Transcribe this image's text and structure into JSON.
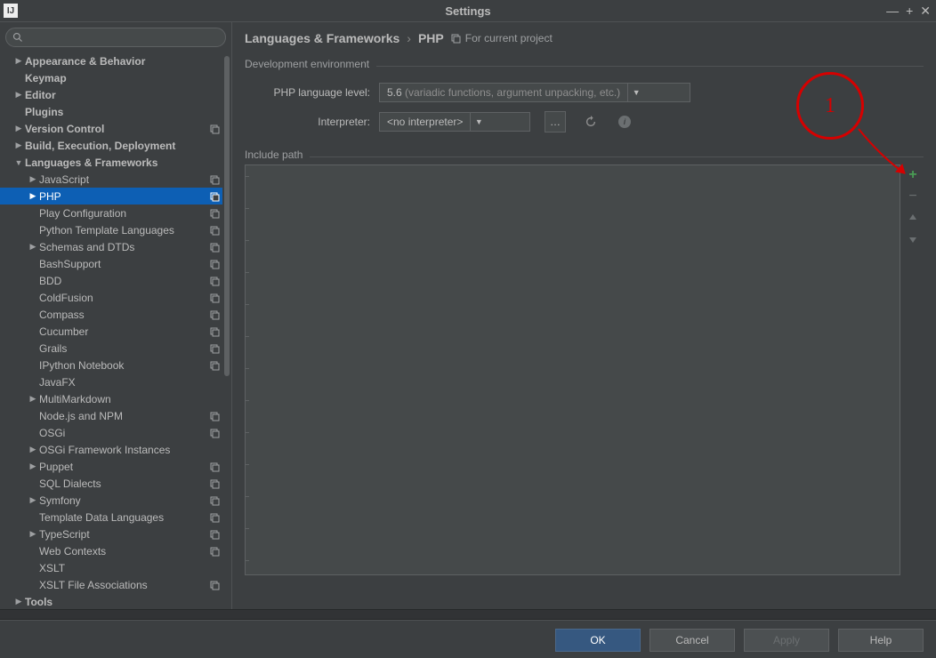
{
  "window": {
    "title": "Settings",
    "app_glyph": "IJ"
  },
  "win_controls": {
    "min": "—",
    "max": "+",
    "close": "✕"
  },
  "search": {
    "placeholder": "",
    "value": ""
  },
  "tree": [
    {
      "label": "Appearance & Behavior",
      "indent": 0,
      "arrow": "right",
      "bold": true
    },
    {
      "label": "Keymap",
      "indent": 0,
      "bold": true
    },
    {
      "label": "Editor",
      "indent": 0,
      "arrow": "right",
      "bold": true
    },
    {
      "label": "Plugins",
      "indent": 0,
      "bold": true
    },
    {
      "label": "Version Control",
      "indent": 0,
      "arrow": "right",
      "bold": true,
      "copy": true
    },
    {
      "label": "Build, Execution, Deployment",
      "indent": 0,
      "arrow": "right",
      "bold": true
    },
    {
      "label": "Languages & Frameworks",
      "indent": 0,
      "arrow": "down",
      "bold": true
    },
    {
      "label": "JavaScript",
      "indent": 1,
      "arrow": "right",
      "copy": true
    },
    {
      "label": "PHP",
      "indent": 1,
      "arrow": "right",
      "copy": true,
      "selected": true
    },
    {
      "label": "Play Configuration",
      "indent": 1,
      "copy": true
    },
    {
      "label": "Python Template Languages",
      "indent": 1,
      "copy": true
    },
    {
      "label": "Schemas and DTDs",
      "indent": 1,
      "arrow": "right",
      "copy": true
    },
    {
      "label": "BashSupport",
      "indent": 1,
      "copy": true
    },
    {
      "label": "BDD",
      "indent": 1,
      "copy": true
    },
    {
      "label": "ColdFusion",
      "indent": 1,
      "copy": true
    },
    {
      "label": "Compass",
      "indent": 1,
      "copy": true
    },
    {
      "label": "Cucumber",
      "indent": 1,
      "copy": true
    },
    {
      "label": "Grails",
      "indent": 1,
      "copy": true
    },
    {
      "label": "IPython Notebook",
      "indent": 1,
      "copy": true
    },
    {
      "label": "JavaFX",
      "indent": 1
    },
    {
      "label": "MultiMarkdown",
      "indent": 1,
      "arrow": "right"
    },
    {
      "label": "Node.js and NPM",
      "indent": 1,
      "copy": true
    },
    {
      "label": "OSGi",
      "indent": 1,
      "copy": true
    },
    {
      "label": "OSGi Framework Instances",
      "indent": 1,
      "arrow": "right"
    },
    {
      "label": "Puppet",
      "indent": 1,
      "arrow": "right",
      "copy": true
    },
    {
      "label": "SQL Dialects",
      "indent": 1,
      "copy": true
    },
    {
      "label": "Symfony",
      "indent": 1,
      "arrow": "right",
      "copy": true
    },
    {
      "label": "Template Data Languages",
      "indent": 1,
      "copy": true
    },
    {
      "label": "TypeScript",
      "indent": 1,
      "arrow": "right",
      "copy": true
    },
    {
      "label": "Web Contexts",
      "indent": 1,
      "copy": true
    },
    {
      "label": "XSLT",
      "indent": 1
    },
    {
      "label": "XSLT File Associations",
      "indent": 1,
      "copy": true
    },
    {
      "label": "Tools",
      "indent": 0,
      "arrow": "right",
      "bold": true
    }
  ],
  "breadcrumb": {
    "root": "Languages & Frameworks",
    "sep": "›",
    "leaf": "PHP",
    "for_project_label": "For current project"
  },
  "dev_env": {
    "section_label": "Development environment",
    "lang_level_label": "PHP language level:",
    "lang_level_value": "5.6",
    "lang_level_hint": "(variadic functions, argument unpacking, etc.)",
    "interpreter_label": "Interpreter:",
    "interpreter_value": "<no interpreter>",
    "ellipsis_label": "…"
  },
  "include": {
    "section_label": "Include path"
  },
  "footer": {
    "ok": "OK",
    "cancel": "Cancel",
    "apply": "Apply",
    "help": "Help"
  },
  "annotation": {
    "number": "1"
  }
}
